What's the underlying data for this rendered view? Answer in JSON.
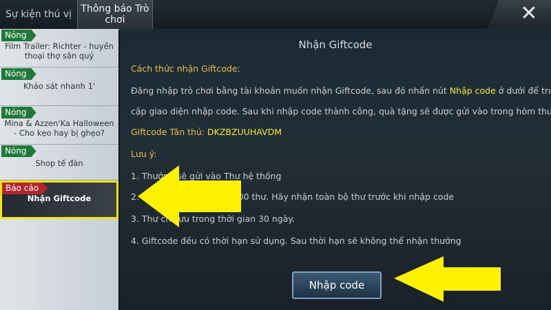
{
  "tabs": [
    {
      "label": "Sự kiện thú vị"
    },
    {
      "label": "Thông báo Trò chơi"
    }
  ],
  "close_label": "✕",
  "sidebar": {
    "items": [
      {
        "badge": "Nóng",
        "text": "Film Trailer: Richter - huyền thoại thợ săn quỷ"
      },
      {
        "badge": "Nóng",
        "text": "Khảo sát nhanh 1'"
      },
      {
        "badge": "Nóng",
        "text": "Mina & Azzen'Ka Halloween - Cho kẹo hay bị ghẹo?"
      },
      {
        "badge": "Nóng",
        "text": "Shop tế đàn"
      },
      {
        "badge": "Báo cáo",
        "text": "Nhận Giftcode"
      }
    ]
  },
  "content": {
    "title": "Nhận Giftcode",
    "howto_heading": "Cách thức nhận Giftcode:",
    "desc_part1": "Đăng nhập trò chơi bằng tài khoản muốn nhận Giftcode, sau đó nhấn nút",
    "desc_highlight": "Nhập code",
    "desc_part2": "ở dưới để truy",
    "desc_line2": "cập giao diện nhập code. Sau khi nhập code thành công, quà tặng sẽ được gửi vào trong hòm thư.",
    "code_label": "Giftcode Tân thủ:",
    "code_value": "DKZBZUUHAVDM",
    "note_heading": "Lưu ý:",
    "notes": [
      "1. Thưởng sẽ gửi vào Thư hệ thống",
      "2. Hòm thư chứa tối đa 100 thư. Hãy nhận toàn bộ thư trước khi nhập code",
      "3. Thư chỉ lưu trong thời gian 30 ngày.",
      "4. Giftcode đều có thời hạn sử dụng. Sau thời hạn sẽ không thể nhận thưởng"
    ],
    "button_label": "Nhập code"
  },
  "colors": {
    "annotation_arrow": "#fff200",
    "selection_border": "#f3e600"
  }
}
